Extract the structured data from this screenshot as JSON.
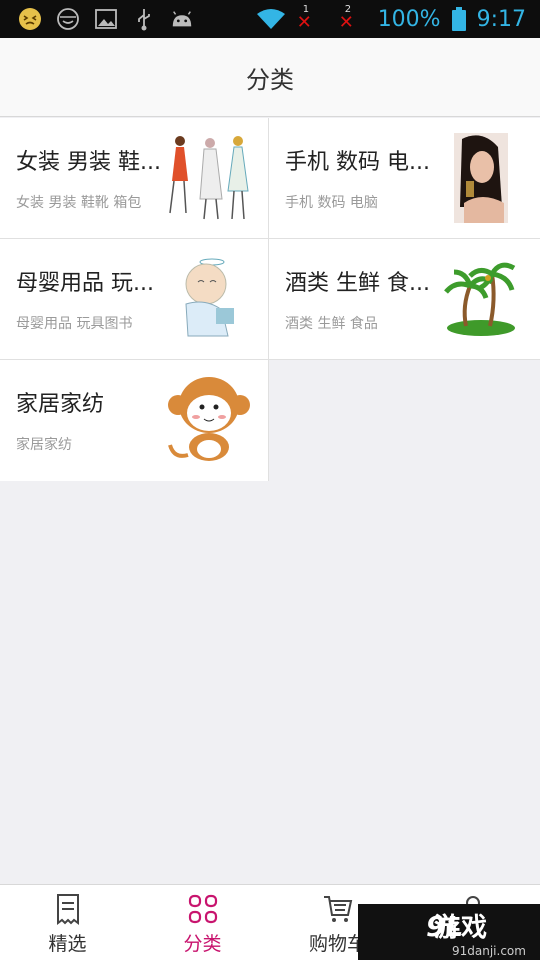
{
  "status_bar": {
    "battery": "100%",
    "time": "9:17",
    "sim1": "1",
    "sim2": "2",
    "icons": [
      "emoji-face-icon",
      "mask-face-icon",
      "image-icon",
      "usb-icon",
      "android-icon",
      "wifi-icon",
      "battery-icon"
    ]
  },
  "header": {
    "title": "分类"
  },
  "categories": [
    {
      "title": "女装 男装 鞋...",
      "subtitle": "女装 男装 鞋靴 箱包",
      "image": "fashion-sketch-image"
    },
    {
      "title": "手机 数码 电...",
      "subtitle": "手机 数码 电脑",
      "image": "woman-phone-image"
    },
    {
      "title": "母婴用品 玩...",
      "subtitle": "母婴用品 玩具图书",
      "image": "baby-cartoon-image"
    },
    {
      "title": "酒类 生鲜 食...",
      "subtitle": "酒类 生鲜 食品",
      "image": "palm-island-image"
    },
    {
      "title": "家居家纺",
      "subtitle": "家居家纺",
      "image": "monkey-cartoon-image"
    }
  ],
  "bottom_nav": [
    {
      "label": "精选",
      "icon": "receipt-icon",
      "active": false
    },
    {
      "label": "分类",
      "icon": "grid-icon",
      "active": true
    },
    {
      "label": "购物车",
      "icon": "cart-icon",
      "active": false
    },
    {
      "label": "",
      "icon": "profile-icon",
      "active": false
    }
  ],
  "watermark": {
    "logo": "9L",
    "main": "游戏",
    "sub": "91danji.com"
  },
  "colors": {
    "accent": "#c8146e",
    "status_text": "#33b5e5",
    "status_bg": "#0d0d0d"
  }
}
